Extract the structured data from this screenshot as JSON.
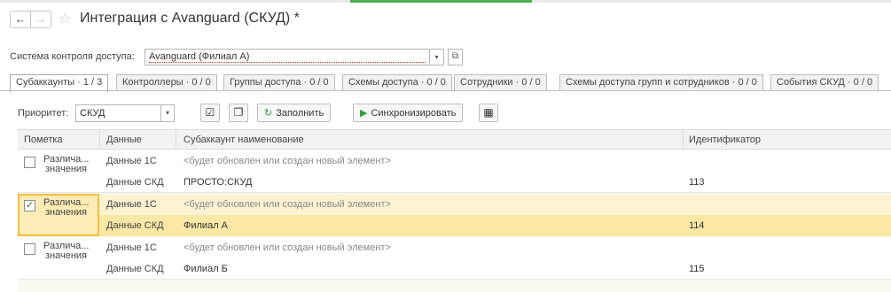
{
  "window": {
    "title": "Интеграция с Avanguard (СКУД) *"
  },
  "nav": {
    "back_icon": "arrow-left-icon",
    "forward_icon": "arrow-right-icon",
    "favorite_icon": "star-icon"
  },
  "system": {
    "label": "Система контроля доступа:",
    "value": "Avanguard (Филиал А)"
  },
  "tabs": [
    {
      "label": "Субаккаунты · 1 / 3",
      "active": true
    },
    {
      "label": "Контроллеры · 0 / 0"
    },
    {
      "label": "Группы доступа · 0 / 0"
    },
    {
      "label": "Схемы доступа · 0 / 0"
    },
    {
      "label": "Сотрудники · 0 / 0"
    },
    {
      "label": "Схемы доступа групп и сотрудников · 0 / 0"
    },
    {
      "label": "События СКУД · 0 / 0"
    }
  ],
  "toolbar": {
    "priority_label": "Приоритет:",
    "priority_value": "СКУД",
    "fill_label": "Заполнить",
    "sync_label": "Синхронизировать"
  },
  "grid": {
    "headers": {
      "mark": "Пометка",
      "data": "Данные",
      "name": "Субаккаунт наименование",
      "id": "Идентификатор"
    },
    "rows": [
      {
        "mark_l1": "Различа...",
        "mark_l2": "значения",
        "checked": false,
        "top": {
          "data": "Данные 1С",
          "name": "<будет обновлен или создан новый элемент>",
          "id": ""
        },
        "bottom": {
          "data": "Данные СКД",
          "name": "ПРОСТО:СКУД",
          "id": "113"
        }
      },
      {
        "mark_l1": "Различа...",
        "mark_l2": "значения",
        "checked": true,
        "selected": true,
        "top": {
          "data": "Данные 1С",
          "name": "<будет обновлен или создан новый элемент>",
          "id": ""
        },
        "bottom": {
          "data": "Данные СКД",
          "name": "Филиал А",
          "id": "114"
        }
      },
      {
        "mark_l1": "Различа...",
        "mark_l2": "значения",
        "checked": false,
        "top": {
          "data": "Данные 1С",
          "name": "<будет обновлен или создан новый элемент>",
          "id": ""
        },
        "bottom": {
          "data": "Данные СКД",
          "name": "Филиал Б",
          "id": "115"
        }
      }
    ]
  },
  "colors": {
    "selected_row": "#fdf3d3",
    "selected_cell_border": "#f0c040",
    "accent_green": "#2e9e3c"
  }
}
